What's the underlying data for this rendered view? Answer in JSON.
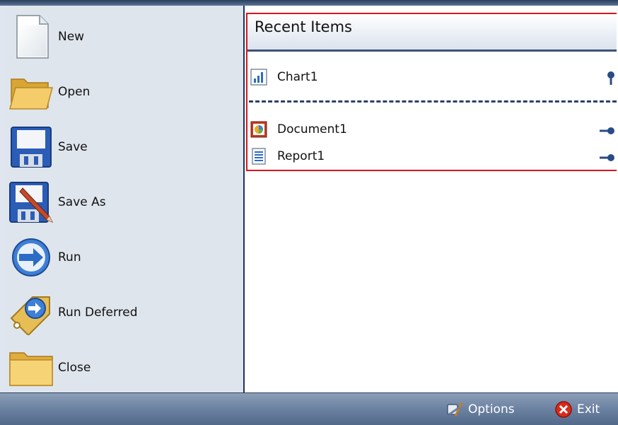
{
  "menu": {
    "items": [
      {
        "label": "New",
        "icon": "new-document-icon"
      },
      {
        "label": "Open",
        "icon": "open-folder-icon"
      },
      {
        "label": "Save",
        "icon": "save-disk-icon"
      },
      {
        "label": "Save As",
        "icon": "save-as-disk-pencil-icon"
      },
      {
        "label": "Run",
        "icon": "run-arrow-icon"
      },
      {
        "label": "Run Deferred",
        "icon": "run-deferred-tag-icon"
      },
      {
        "label": "Close",
        "icon": "close-folder-icon"
      }
    ]
  },
  "recent": {
    "title": "Recent Items",
    "pinned": [
      {
        "label": "Chart1",
        "icon": "chart-icon",
        "pinned": true
      }
    ],
    "items": [
      {
        "label": "Document1",
        "icon": "document-icon",
        "pinned": false
      },
      {
        "label": "Report1",
        "icon": "report-icon",
        "pinned": false
      }
    ]
  },
  "footer": {
    "options_label": "Options",
    "exit_label": "Exit"
  },
  "colors": {
    "highlight_border": "#d7161f",
    "header_rule": "#3d5377",
    "bottom_bar": "#6e84a3"
  }
}
